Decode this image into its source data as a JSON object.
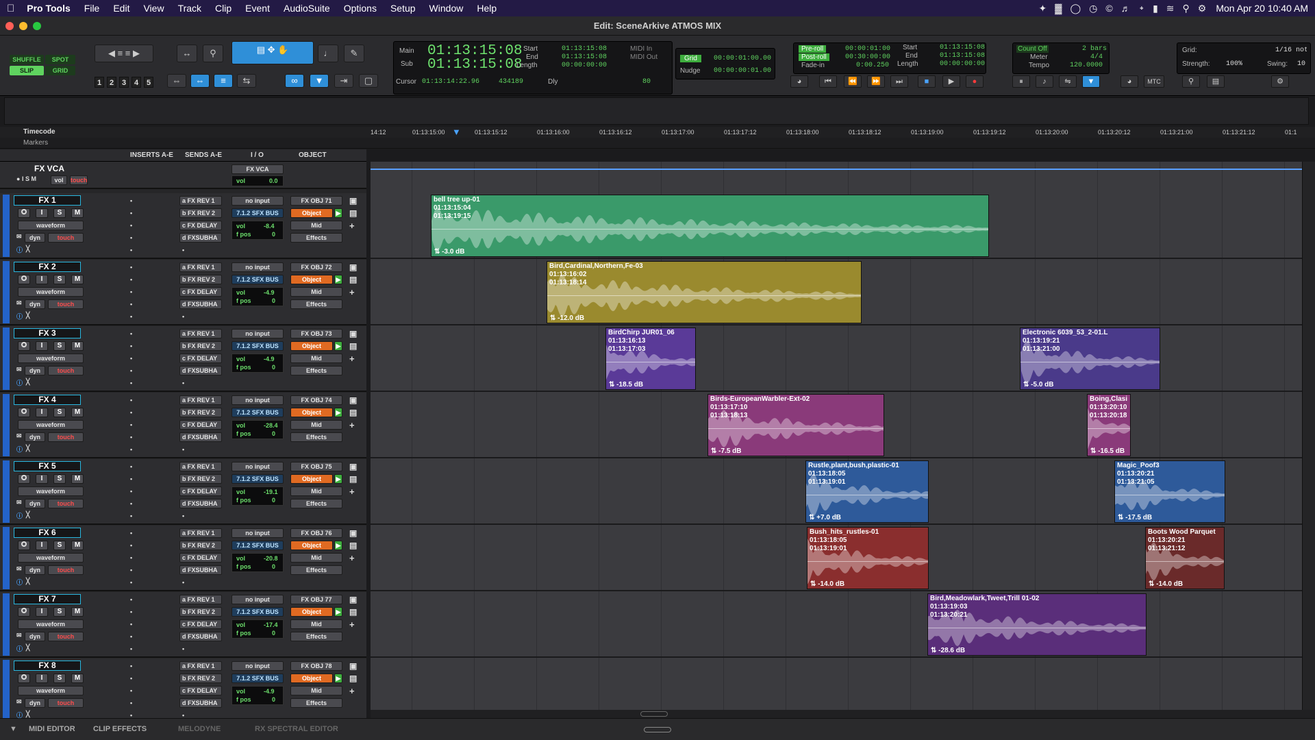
{
  "menubar": {
    "app": "Pro Tools",
    "items": [
      "File",
      "Edit",
      "View",
      "Track",
      "Clip",
      "Event",
      "AudioSuite",
      "Options",
      "Setup",
      "Window",
      "Help"
    ],
    "datetime": "Mon Apr 20  10:40 AM"
  },
  "window": {
    "title": "Edit: SceneArkive ATMOS MIX"
  },
  "toolbar": {
    "modes": {
      "shuffle": "SHUFFLE",
      "spot": "SPOT",
      "slip": "SLIP",
      "grid": "GRID"
    },
    "zoom_presets": [
      "1",
      "2",
      "3",
      "4",
      "5"
    ],
    "counter": {
      "main_label": "Main",
      "main": "01:13:15:08",
      "sub_label": "Sub",
      "sub": "01:13:15:08",
      "cursor_label": "Cursor",
      "cursor": "01:13:14:22.96",
      "cursor_sample": "434189",
      "dly": "Dly",
      "zoom_val": "80"
    },
    "selection": {
      "start_label": "Start",
      "end_label": "End",
      "length_label": "Length",
      "start": "01:13:15:08",
      "end": "01:13:15:08",
      "length": "00:00:00:00",
      "midi_in": "MIDI In",
      "midi_out": "MIDI Out"
    },
    "grid": {
      "grid_label": "Grid",
      "grid_val": "00:00:01:00.00",
      "nudge_label": "Nudge",
      "nudge_val": "00:00:00:01.00"
    },
    "transport": {
      "preroll_label": "Pre-roll",
      "preroll": "00:00:01:00",
      "postroll_label": "Post-roll",
      "postroll": "00:30:00:00",
      "fadein_label": "Fade-in",
      "fadein": "0:00.250",
      "start_label": "Start",
      "start": "01:13:15:08",
      "end_label": "End",
      "end": "01:13:15:08",
      "length_label": "Length",
      "length": "00:00:00:00",
      "mtc": "MTC"
    },
    "meter": {
      "countoff_label": "Count Off",
      "countoff": "2 bars",
      "meter_label": "Meter",
      "meter": "4/4",
      "tempo_label": "Tempo",
      "tempo": "120.0000"
    },
    "quantize": {
      "grid_label": "Grid:",
      "grid_val": "1/16 note",
      "strength_label": "Strength:",
      "strength": "100%",
      "swing_label": "Swing:",
      "swing": "10"
    }
  },
  "rulers": {
    "timecode": "Timecode",
    "markers": "Markers",
    "ticks": [
      "14:12",
      "01:13:15:00",
      "01:13:15:12",
      "01:13:16:00",
      "01:13:16:12",
      "01:13:17:00",
      "01:13:17:12",
      "01:13:18:00",
      "01:13:18:12",
      "01:13:19:00",
      "01:13:19:12",
      "01:13:20:00",
      "01:13:20:12",
      "01:13:21:00",
      "01:13:21:12",
      "01:1"
    ]
  },
  "columns": {
    "inserts": "INSERTS A-E",
    "sends": "SENDS A-E",
    "io": "I / O",
    "object": "OBJECT"
  },
  "vca": {
    "name": "FX VCA",
    "i": "I",
    "s": "S",
    "m": "M",
    "vol": "vol",
    "touch": "touch",
    "io": "FX VCA",
    "vol_label": "vol",
    "vol_val": "0.0"
  },
  "track_common": {
    "rec": "",
    "i": "I",
    "s": "S",
    "m": "M",
    "view": "waveform",
    "dyn": "dyn",
    "touch": "touch",
    "sends": [
      "a  FX REV 1",
      "b  FX REV 2",
      "c  FX DELAY",
      "d  FXSUBHA"
    ],
    "input": "no input",
    "output": "7.1.2 SFX BUS",
    "object_btn": "Object",
    "mid": "Mid",
    "effects": "Effects",
    "vol_label": "vol",
    "fpos_label": "f pos",
    "fpos_val": "0"
  },
  "tracks": [
    {
      "name": "FX 1",
      "obj": "FX OBJ 71",
      "vol": "-8.4"
    },
    {
      "name": "FX 2",
      "obj": "FX OBJ 72",
      "vol": "-4.9"
    },
    {
      "name": "FX 3",
      "obj": "FX OBJ 73",
      "vol": "-4.9"
    },
    {
      "name": "FX 4",
      "obj": "FX OBJ 74",
      "vol": "-28.4"
    },
    {
      "name": "FX 5",
      "obj": "FX OBJ 75",
      "vol": "-19.1"
    },
    {
      "name": "FX 6",
      "obj": "FX OBJ 76",
      "vol": "-20.8"
    },
    {
      "name": "FX 7",
      "obj": "FX OBJ 77",
      "vol": "-17.4"
    },
    {
      "name": "FX 8",
      "obj": "FX OBJ 78",
      "vol": "-4.9"
    }
  ],
  "clips": [
    {
      "name": "bell tree up-01",
      "start": "01:13:15:04",
      "end": "01:13:19:15",
      "gain": "-3.0 dB",
      "color": "#3a9a6a"
    },
    {
      "name": "Bird,Cardinal,Northern,Fe-03",
      "start": "01:13:16:02",
      "end": "01:13:18:14",
      "gain": "-12.0 dB",
      "color": "#9a8a2e"
    },
    {
      "name": "BirdChirp JUR01_06",
      "start": "01:13:16:13",
      "end": "01:13:17:03",
      "gain": "-18.5 dB",
      "color": "#5a3a98"
    },
    {
      "name": "Electronic 6039_53_2-01.L",
      "start": "01:13:19:21",
      "end": "01:13:21:00",
      "gain": "-5.0 dB",
      "color": "#4a3a8a"
    },
    {
      "name": "Birds-EuropeanWarbler-Ext-02",
      "start": "01:13:17:10",
      "end": "01:13:18:13",
      "gain": "-7.5 dB",
      "color": "#8a3a7a"
    },
    {
      "name": "Boing,Clasi",
      "start": "01:13:20:10",
      "end": "01:13:20:18",
      "gain": "-16.5 dB",
      "color": "#8a3a7a"
    },
    {
      "name": "Rustle,plant,bush,plastic-01",
      "start": "01:13:18:05",
      "end": "01:13:19:01",
      "gain": "+7.0 dB",
      "color": "#2e5a9a"
    },
    {
      "name": "Magic_Poof3",
      "start": "01:13:20:21",
      "end": "01:13:21:05",
      "gain": "-17.5 dB",
      "color": "#2e5a9a"
    },
    {
      "name": "Bush_hits_rustles-01",
      "start": "01:13:18:05",
      "end": "01:13:19:01",
      "gain": "-14.0 dB",
      "color": "#8a2e2e"
    },
    {
      "name": "Boots Wood Parquet",
      "start": "01:13:20:21",
      "end": "01:13:21:12",
      "gain": "-14.0 dB",
      "color": "#6a2a2a"
    },
    {
      "name": "Bird,Meadowlark,Tweet,Trill 01-02",
      "start": "01:13:19:03",
      "end": "01:13:20:21",
      "gain": "-28.6 dB",
      "color": "#5a2e7a"
    }
  ],
  "bottom_tabs": [
    "MIDI EDITOR",
    "CLIP EFFECTS",
    "MELODYNE",
    "RX SPECTRAL EDITOR"
  ]
}
